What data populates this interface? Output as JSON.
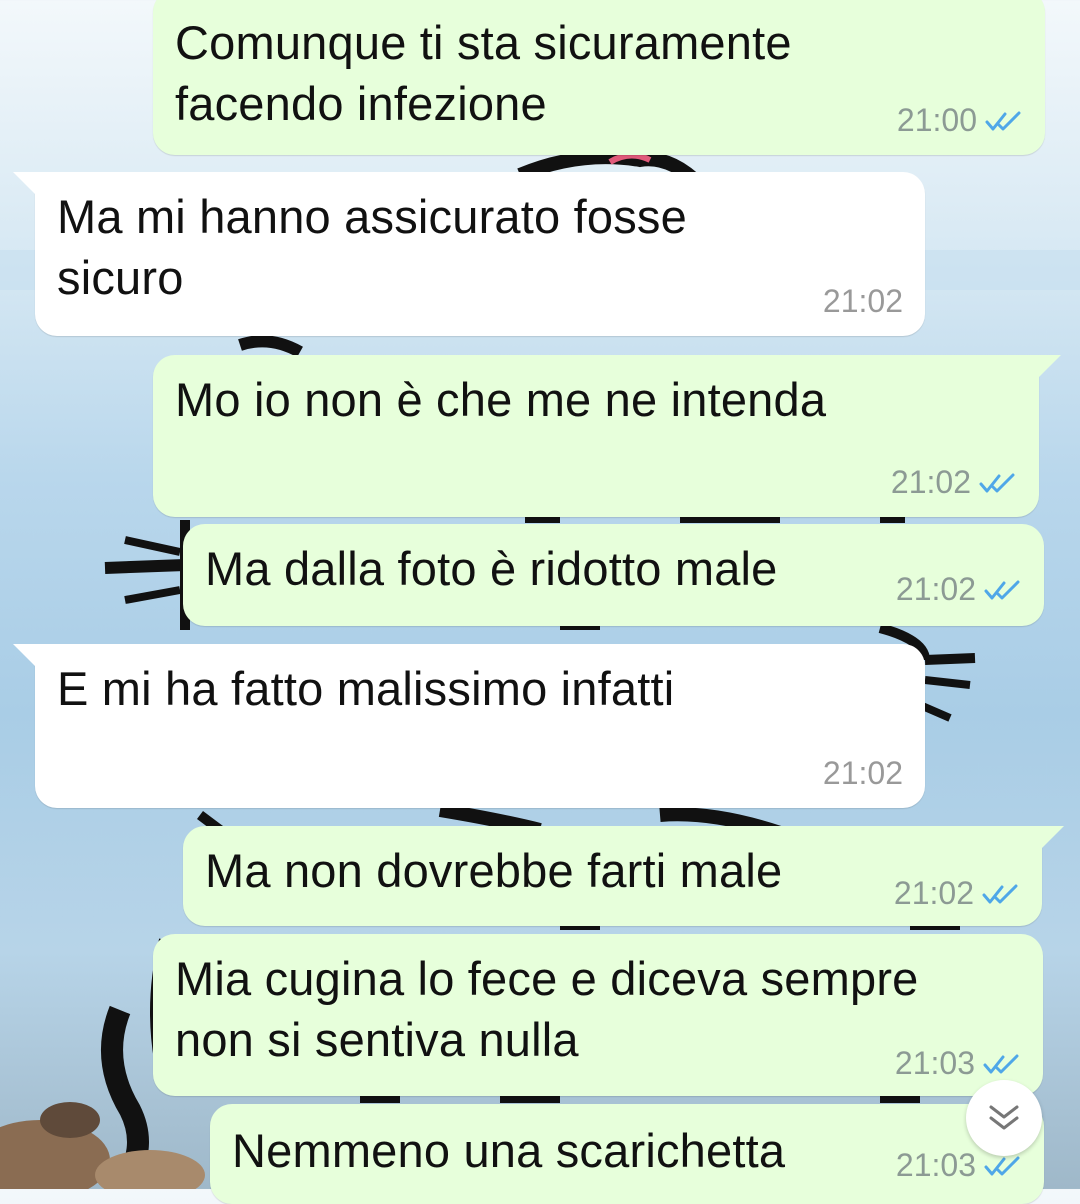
{
  "messages": [
    {
      "direction": "outgoing",
      "text": "Comunque ti sta sicuramente\nfacendo infezione",
      "time": "21:00",
      "status": "read"
    },
    {
      "direction": "incoming",
      "text": "Ma mi hanno assicurato fosse\nsicuro",
      "time": "21:02"
    },
    {
      "direction": "outgoing",
      "text": "Mo io non è che me ne intenda",
      "time": "21:02",
      "status": "read"
    },
    {
      "direction": "outgoing",
      "text": "Ma dalla foto è ridotto male",
      "time": "21:02",
      "status": "read"
    },
    {
      "direction": "incoming",
      "text": "E mi ha fatto malissimo infatti",
      "time": "21:02"
    },
    {
      "direction": "outgoing",
      "text": "Ma non dovrebbe farti male",
      "time": "21:02",
      "status": "read"
    },
    {
      "direction": "outgoing",
      "text": "Mia cugina lo fece e diceva sempre\nnon si sentiva nulla",
      "time": "21:03",
      "status": "read"
    },
    {
      "direction": "outgoing",
      "text": "Nemmeno una scarichetta",
      "time": "21:03",
      "status": "read"
    }
  ],
  "colors": {
    "outgoing_bubble": "#e7ffdb",
    "incoming_bubble": "#ffffff",
    "read_ticks": "#4fa7e8",
    "timestamp": "#8c9a94"
  },
  "icons": {
    "read_receipt": "double-check-icon",
    "scroll_down": "double-chevron-down-icon"
  }
}
